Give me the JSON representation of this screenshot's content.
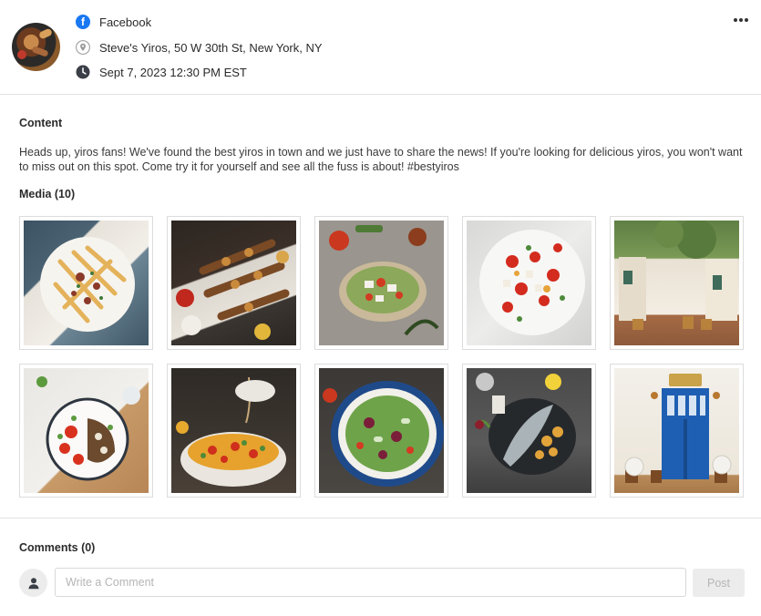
{
  "post": {
    "platform": "Facebook",
    "location": "Steve's Yiros,  50 W 30th St, New York, NY",
    "datetime": "Sept 7, 2023 12:30 PM EST",
    "platform_color": "#1877f2",
    "icons": {
      "platform": "facebook-icon",
      "location": "location-pin-icon",
      "time": "clock-icon",
      "more": "more-options-icon"
    }
  },
  "content": {
    "label": "Content",
    "text": "Heads up, yiros fans! We've found the best yiros in town and we just have to share the news! If you're looking for delicious yiros, you won't want to miss out on this spot. Come try it for yourself and see all the fuss is about! #bestyiros"
  },
  "media": {
    "label": "Media (10)",
    "items": [
      {
        "name": "yiros-fries-plate"
      },
      {
        "name": "souvlaki-skewers"
      },
      {
        "name": "greek-salad-plate"
      },
      {
        "name": "tomato-feta-salad"
      },
      {
        "name": "greek-street-cafe"
      },
      {
        "name": "grilled-eggplant-salad"
      },
      {
        "name": "dressing-salad-bowl"
      },
      {
        "name": "blue-bowl-salad"
      },
      {
        "name": "grilled-fish-potatoes"
      },
      {
        "name": "blue-door-taverna"
      }
    ]
  },
  "comments": {
    "label": "Comments (0)",
    "placeholder": "Write a Comment",
    "post_label": "Post",
    "icons": {
      "avatar": "user-avatar-icon"
    }
  }
}
